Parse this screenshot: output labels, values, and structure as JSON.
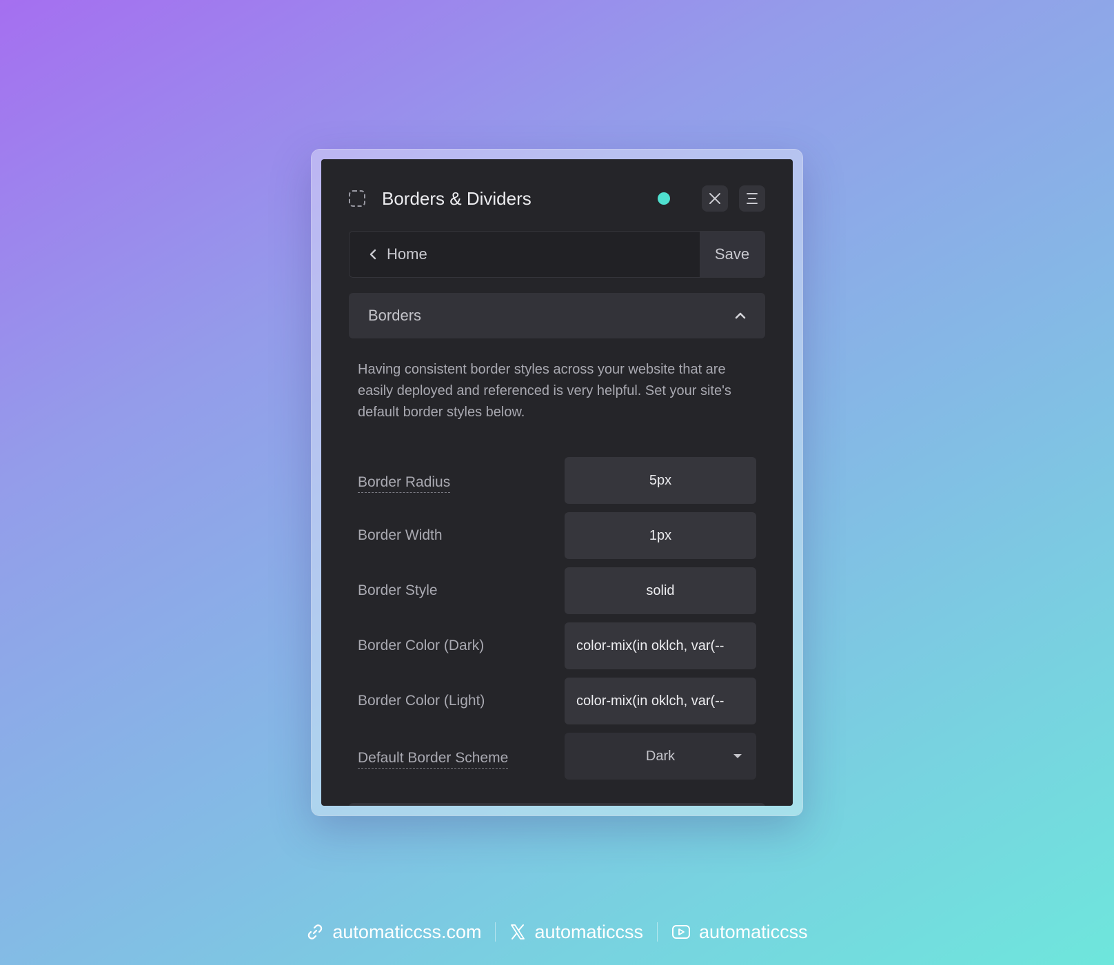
{
  "panel": {
    "title": "Borders & Dividers",
    "status_color": "#4fe0cf",
    "nav": {
      "back_label": "Home",
      "save_label": "Save"
    },
    "section": {
      "title": "Borders",
      "description": "Having consistent border styles across your website that are easily deployed and referenced is very helpful. Set your site's default border styles below."
    },
    "fields": {
      "border_radius": {
        "label": "Border Radius",
        "value": "5px"
      },
      "border_width": {
        "label": "Border Width",
        "value": "1px"
      },
      "border_style": {
        "label": "Border Style",
        "value": "solid"
      },
      "border_color_dark": {
        "label": "Border Color (Dark)",
        "value": "color-mix(in oklch, var(--"
      },
      "border_color_light": {
        "label": "Border Color (Light)",
        "value": "color-mix(in oklch, var(--"
      },
      "default_border_scheme": {
        "label": "Default Border Scheme",
        "value": "Dark"
      }
    }
  },
  "footer": {
    "website": "automaticcss.com",
    "x_handle": "automaticcss",
    "youtube_handle": "automaticcss"
  }
}
